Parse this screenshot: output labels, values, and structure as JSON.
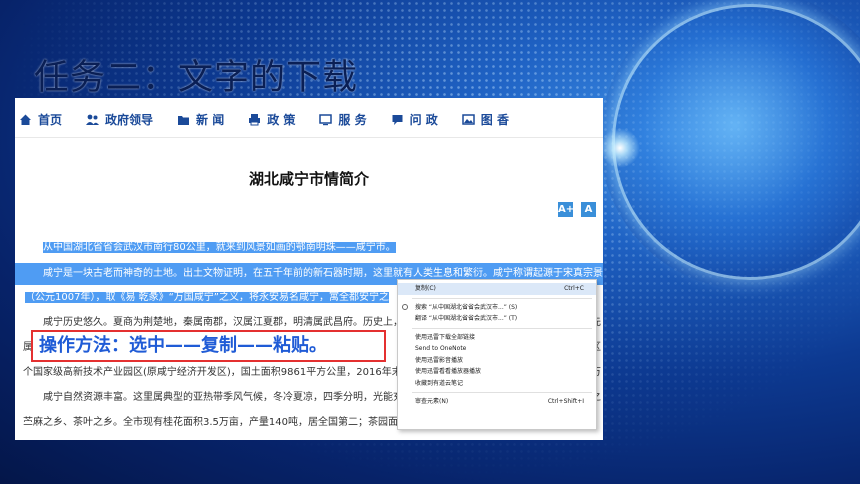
{
  "slide": {
    "title": "任务二：文字的下载",
    "callout": "操作方法：选中——复制——粘贴。"
  },
  "nav": {
    "items": [
      {
        "label": "首页",
        "icon": "home-icon"
      },
      {
        "label": "政府领导",
        "icon": "people-icon"
      },
      {
        "label": "新 闻",
        "icon": "folder-icon"
      },
      {
        "label": "政 策",
        "icon": "printer-icon"
      },
      {
        "label": "服 务",
        "icon": "monitor-icon"
      },
      {
        "label": "问 政",
        "icon": "chat-icon"
      },
      {
        "label": "图 香",
        "icon": "image-icon"
      }
    ]
  },
  "article": {
    "title": "湖北咸宁市情简介",
    "font_increase": "A+",
    "font_decrease": "A",
    "paragraphs": [
      "从中国湖北省省会武汉市南行80公里，就来到风景如画的鄂南明珠——咸宁市。",
      "咸宁是一块古老而神奇的土地。出土文物证明，在五千年前的新石器时期，这里就有人类生息和繁衍。咸宁称谓起源于宋真宗景德",
      "（公元1007年），取《易 乾彖》“万国咸宁”之义，将永安易名咸宁，寓全都安宁之",
      "咸宁历史悠久。夏商为荆楚地，秦属南郡，汉属江夏郡，明清属武昌府。历史上，",
      "属",
      "个国家级高新技术产业园区(原咸宁经济开发区)，国土面积9861平方公里，2016年末全",
      "咸宁自然资源丰富。这里属典型的亚热带季风气候，冬冷夏凉，四季分明，光能充",
      "苎麻之乡、茶叶之乡。全市现有桂花面积3.5万亩，产量140吨，居全国第二；茶园面积"
    ],
    "right_edge_fragments": [
      "先",
      "区",
      "万",
      "之"
    ]
  },
  "context_menu": {
    "items": [
      {
        "label": "复制(C)",
        "shortcut": "Ctrl+C"
      },
      {
        "label": "搜索 “从中国湖北省省会武汉市...” (S)",
        "shortcut": ""
      },
      {
        "label": "翻译 “从中国湖北省省会武汉市...” (T)",
        "shortcut": ""
      },
      {
        "label": "使用迅雷下载全部链接",
        "shortcut": ""
      },
      {
        "label": "Send to OneNote",
        "shortcut": ""
      },
      {
        "label": "使用迅雷影音播放",
        "shortcut": ""
      },
      {
        "label": "使用迅雷看看播放器播放",
        "shortcut": ""
      },
      {
        "label": "收藏到有道云笔记",
        "shortcut": ""
      },
      {
        "label": "审查元素(N)",
        "shortcut": "Ctrl+Shift+I"
      }
    ]
  },
  "colors": {
    "nav_text": "#1b4a99",
    "selection": "#4f9cf3",
    "callout_text": "#1f5bd6",
    "callout_border": "#e43030"
  }
}
